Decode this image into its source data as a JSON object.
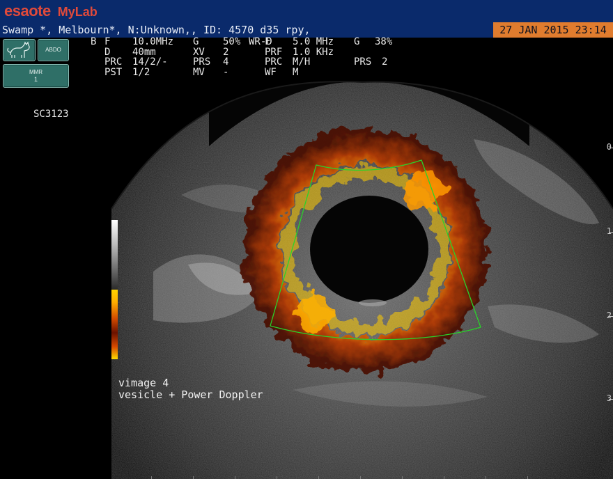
{
  "header": {
    "brand_main": "esaote",
    "brand_sub": "MyLab"
  },
  "patient_bar": {
    "text": "Swamp *, Melbourn*, N:Unknown,, ID: 4570 d35 rpy,",
    "datetime": "27 JAN 2015 23:14"
  },
  "left_panel": {
    "species_button_icon": "cat-icon",
    "abdo_label": "ABDO",
    "mmr_label_line1": "MMR",
    "mmr_label_line2": "1"
  },
  "params": {
    "b": {
      "mode": "B",
      "f": "F",
      "f_val": "10.0MHz",
      "g": "G",
      "g_val": "50%",
      "d": "D",
      "d_val": "40mm",
      "xv": "XV",
      "xv_val": "2",
      "prc": "PRC",
      "prc_val": "14/2/-",
      "prs": "PRS",
      "prs_val": "4",
      "pst": "PST",
      "pst_val": "1/2",
      "mv": "MV",
      "mv_val": "-"
    },
    "doppler": {
      "mode": "WR-D",
      "f": "F",
      "f_val": "5.0 MHz",
      "g": "G",
      "g_val": "38%",
      "prf": "PRF",
      "prf_val": "1.0 KHz",
      "prc": "PRC",
      "prc_val": "M/H",
      "prs": "PRS",
      "prs_val": "2",
      "wf": "WF",
      "wf_val": "M"
    }
  },
  "probe_label": "SC3123",
  "caption": {
    "line1": "vimage 4",
    "line2": "vesicle + Power Doppler"
  },
  "depth_marks": [
    "0",
    "1",
    "2",
    "3"
  ],
  "colors": {
    "topbar": "#0a2a6b",
    "date_bg": "#e07c2e",
    "brand": "#e04a3b",
    "roi": "#29d32a"
  }
}
